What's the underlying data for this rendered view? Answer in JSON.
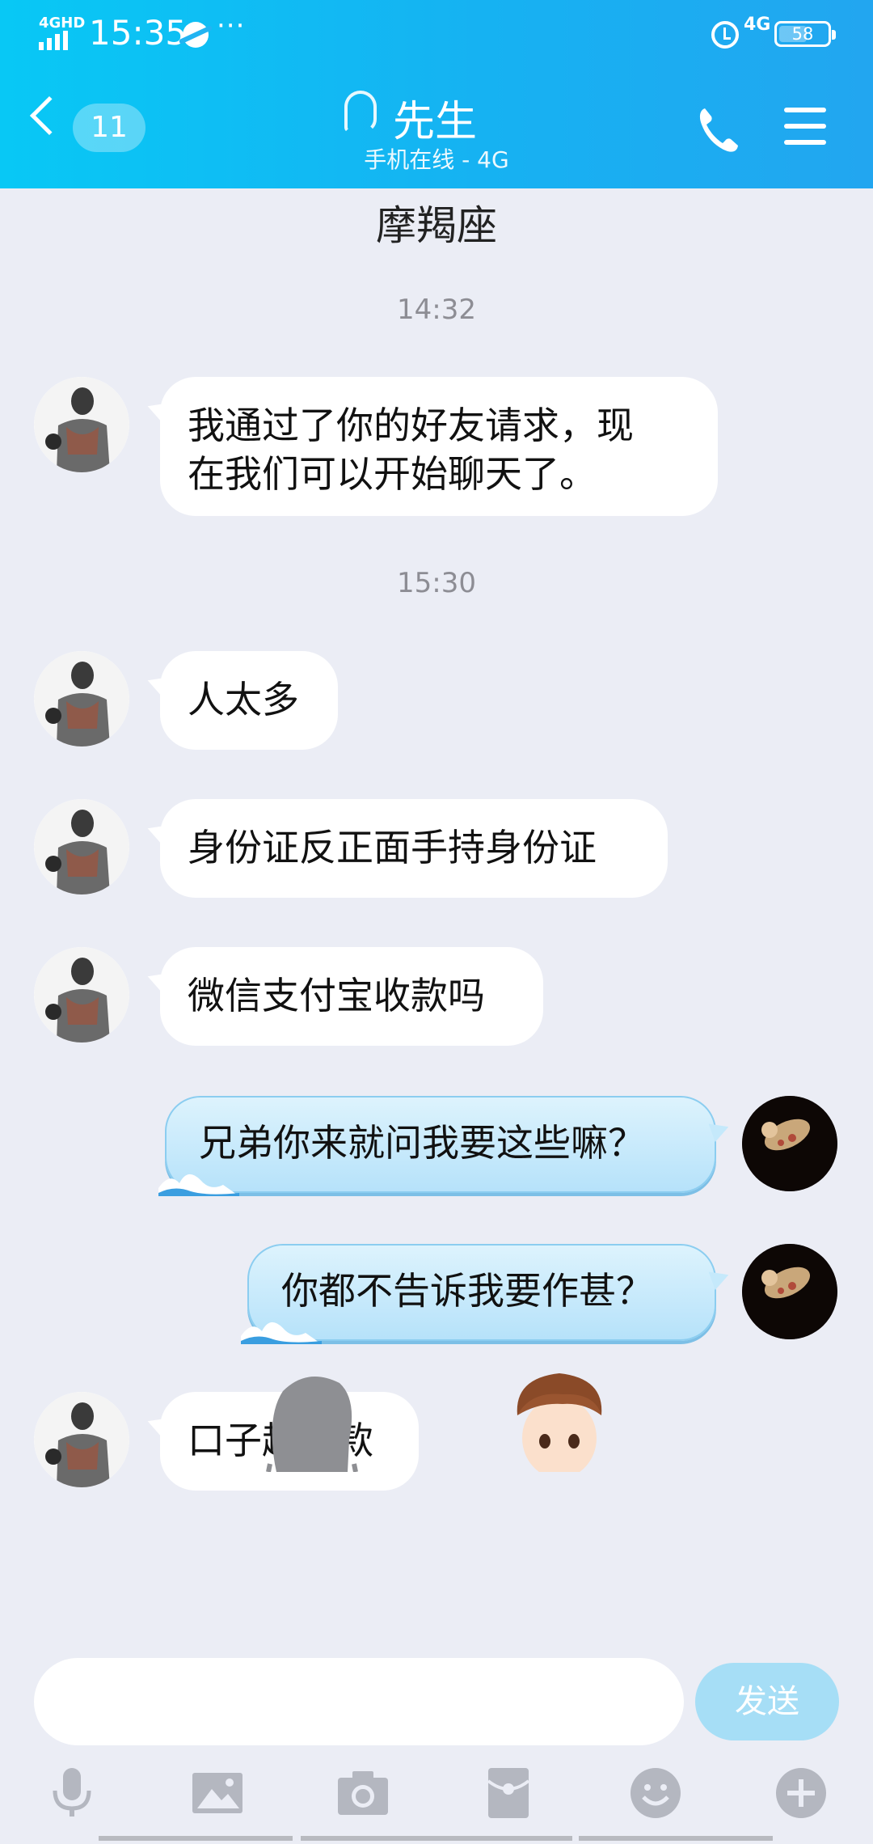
{
  "status_bar": {
    "network_label": "4GHD",
    "time": "15:35",
    "more": "···",
    "network_right": "4G",
    "battery": "58"
  },
  "header": {
    "unread_count": "11",
    "contact_name": "先生",
    "contact_status": "手机在线 - 4G"
  },
  "chat": {
    "zodiac": "摩羯座",
    "timestamps": [
      "14:32",
      "15:30"
    ],
    "messages": [
      {
        "side": "left",
        "text_line1": "我通过了你的好友请求，现",
        "text_line2": "在我们可以开始聊天了。"
      },
      {
        "side": "left",
        "text": "人太多"
      },
      {
        "side": "left",
        "text": "身份证反正面手持身份证"
      },
      {
        "side": "left",
        "text": "微信支付宝收款吗"
      },
      {
        "side": "right",
        "text": "兄弟你来就问我要这些嘛？"
      },
      {
        "side": "right",
        "text": "你都不告诉我要作甚？"
      },
      {
        "side": "left",
        "text": "口子趣借款"
      }
    ]
  },
  "composer": {
    "placeholder": "",
    "send_label": "发送"
  },
  "toolbar": {
    "icons": [
      "microphone-icon",
      "image-icon",
      "camera-icon",
      "red-packet-icon",
      "emoji-icon",
      "plus-icon"
    ]
  },
  "colors": {
    "header_start": "#08c8f5",
    "header_end": "#22a6f0",
    "chat_bg": "#ebedf5",
    "send_button": "#a6def6",
    "toolbar_icon": "#b4b7c0"
  }
}
